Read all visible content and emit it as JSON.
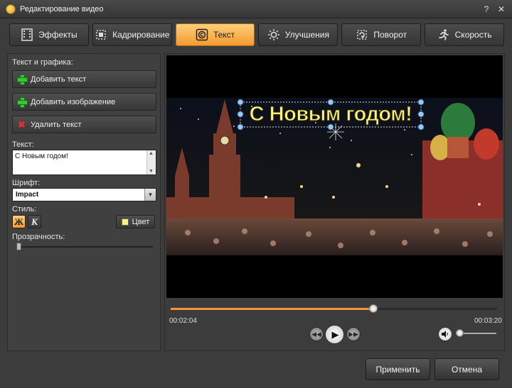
{
  "window": {
    "title": "Редактирование видео",
    "help_label": "?",
    "close_label": "✕"
  },
  "tabs": [
    {
      "label": "Эффекты",
      "icon": "film-icon",
      "active": false
    },
    {
      "label": "Кадрирование",
      "icon": "crop-icon",
      "active": false
    },
    {
      "label": "Текст",
      "icon": "copyright-text-icon",
      "active": true
    },
    {
      "label": "Улучшения",
      "icon": "sun-icon",
      "active": false
    },
    {
      "label": "Поворот",
      "icon": "rotate-icon",
      "active": false
    },
    {
      "label": "Скорость",
      "icon": "running-man-icon",
      "active": false
    }
  ],
  "left_panel": {
    "section_title": "Текст и графика:",
    "add_text": "Добавить текст",
    "add_image": "Добавить изображение",
    "delete_text": "Удалить текст",
    "text_label": "Текст:",
    "text_value": "С Новым годом!",
    "font_label": "Шрифт:",
    "font_value": "Impact",
    "style_label": "Стиль:",
    "bold_glyph": "Ж",
    "italic_glyph": "К",
    "color_label": "Цвет",
    "color_value": "#fff27a",
    "opacity_label": "Прозрачность:",
    "opacity_level": 0
  },
  "preview": {
    "overlay_text": "С Новым годом!"
  },
  "player": {
    "current_time": "00:02:04",
    "total_time": "00:03:20",
    "progress_percent": 62,
    "volume_percent": 5
  },
  "footer": {
    "apply_label": "Применить",
    "cancel_label": "Отмена"
  },
  "colors": {
    "accent": "#f39a2d",
    "overlay_text": "#fff27a",
    "progress": "#f5923a"
  }
}
